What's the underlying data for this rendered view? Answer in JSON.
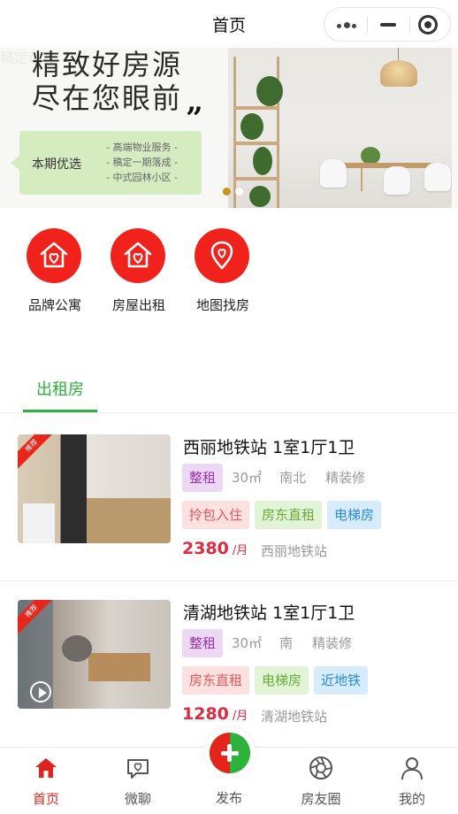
{
  "header": {
    "title": "首页"
  },
  "banner": {
    "line1": "精致好房源",
    "line2": "尽在您眼前",
    "quote": "”",
    "bubble_label": "本期优选",
    "bubble_lines": [
      "- 高端物业服务 -",
      "- 稿定一期落成 -",
      "- 中式园林小区 -"
    ],
    "watermark": "稿定设计"
  },
  "quick_links": [
    {
      "label": "品牌公寓",
      "icon": "house-heart-icon"
    },
    {
      "label": "房屋出租",
      "icon": "house-heart-icon"
    },
    {
      "label": "地图找房",
      "icon": "map-pin-heart-icon"
    }
  ],
  "tabs": [
    {
      "label": "出租房",
      "active": true
    }
  ],
  "listings": [
    {
      "title": "西丽地铁站 1室1厅1卫",
      "badge": "推荐",
      "type_tag": "整租",
      "area": "30㎡",
      "orientation": "南北",
      "decoration": "精装修",
      "tags": [
        "拎包入住",
        "房东直租",
        "电梯房"
      ],
      "price": "2380",
      "unit": "/月",
      "station": "西丽地铁站",
      "has_video": false
    },
    {
      "title": "清湖地铁站 1室1厅1卫",
      "badge": "推荐",
      "type_tag": "整租",
      "area": "30㎡",
      "orientation": "南",
      "decoration": "精装修",
      "tags": [
        "房东直租",
        "电梯房",
        "近地铁"
      ],
      "price": "1280",
      "unit": "/月",
      "station": "清湖地铁站",
      "has_video": true
    }
  ],
  "bottom_nav": [
    {
      "label": "首页",
      "icon": "home-icon",
      "active": true
    },
    {
      "label": "微聊",
      "icon": "chat-heart-icon",
      "active": false
    },
    {
      "label": "发布",
      "icon": "publish-plus-icon",
      "active": false
    },
    {
      "label": "房友圈",
      "icon": "aperture-icon",
      "active": false
    },
    {
      "label": "我的",
      "icon": "user-icon",
      "active": false
    }
  ],
  "colors": {
    "accent_red": "#f0221b",
    "accent_green": "#2cb23b",
    "price_red": "#e02a40",
    "tag_purple": "#9b30b8",
    "tag_pink": "#e8575a",
    "tag_green": "#68a93c",
    "tag_blue": "#2b8ad6"
  }
}
